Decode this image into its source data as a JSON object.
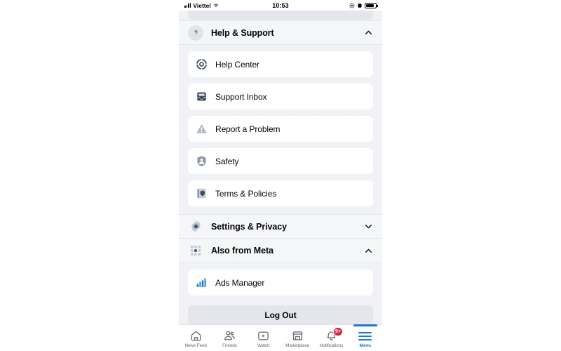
{
  "status_bar": {
    "carrier": "Viettel",
    "time": "10:53",
    "signal_icon": "signal-bars-icon",
    "wifi_icon": "wifi-icon",
    "alarm_icon": "alarm-icon",
    "lock_icon": "rotation-lock-icon",
    "battery_icon": "battery-icon"
  },
  "sections": [
    {
      "id": "help-support",
      "title": "Help & Support",
      "icon": "question-mark-circle-icon",
      "expanded": true,
      "chevron": "chevron-up-icon",
      "items": [
        {
          "label": "Help Center",
          "icon": "lifebuoy-icon"
        },
        {
          "label": "Support Inbox",
          "icon": "inbox-tray-icon"
        },
        {
          "label": "Report a Problem",
          "icon": "warning-triangle-icon"
        },
        {
          "label": "Safety",
          "icon": "shield-person-icon"
        },
        {
          "label": "Terms & Policies",
          "icon": "book-shield-icon"
        }
      ]
    },
    {
      "id": "settings-privacy",
      "title": "Settings & Privacy",
      "icon": "gear-icon",
      "expanded": false,
      "chevron": "chevron-down-icon",
      "items": []
    },
    {
      "id": "also-from-meta",
      "title": "Also from Meta",
      "icon": "dot-grid-icon",
      "expanded": true,
      "chevron": "chevron-up-icon",
      "items": [
        {
          "label": "Ads Manager",
          "icon": "bar-chart-icon"
        }
      ]
    }
  ],
  "logout": {
    "label": "Log Out"
  },
  "tabbar": {
    "tabs": [
      {
        "label": "News Feed",
        "icon": "home-icon",
        "active": false,
        "badge": ""
      },
      {
        "label": "Friends",
        "icon": "friends-icon",
        "active": false,
        "badge": ""
      },
      {
        "label": "Watch",
        "icon": "watch-play-icon",
        "active": false,
        "badge": ""
      },
      {
        "label": "Marketplace",
        "icon": "marketplace-store-icon",
        "active": false,
        "badge": ""
      },
      {
        "label": "Notifications",
        "icon": "bell-icon",
        "active": false,
        "badge": "9+"
      },
      {
        "label": "Menu",
        "icon": "hamburger-menu-icon",
        "active": true,
        "badge": ""
      }
    ]
  },
  "colors": {
    "accent": "#1877f2",
    "badge": "#e41e3f",
    "page_bg": "#f0f2f5",
    "card_bg": "#ffffff",
    "logout_bg": "#e4e6eb",
    "icon_muted": "#65676b"
  }
}
